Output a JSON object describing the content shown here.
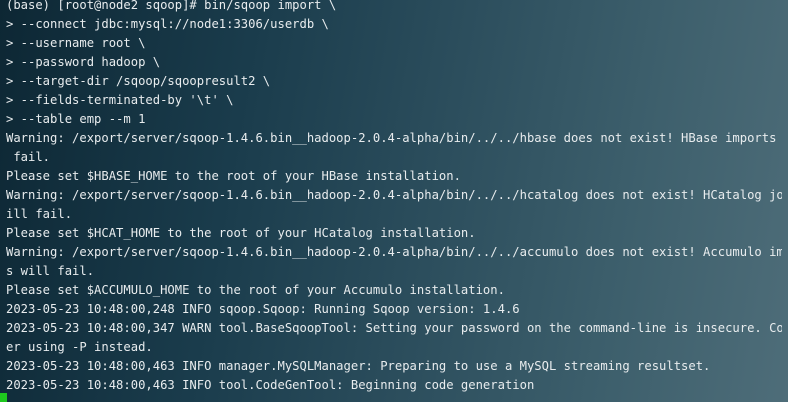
{
  "terminal": {
    "lines": [
      "(base) [root@node2 sqoop]# bin/sqoop import \\",
      "> --connect jdbc:mysql://node1:3306/userdb \\",
      "> --username root \\",
      "> --password hadoop \\",
      "> --target-dir /sqoop/sqoopresult2 \\",
      "> --fields-terminated-by '\\t' \\",
      "> --table emp --m 1",
      "Warning: /export/server/sqoop-1.4.6.bin__hadoop-2.0.4-alpha/bin/../../hbase does not exist! HBase imports will",
      " fail.",
      "Please set $HBASE_HOME to the root of your HBase installation.",
      "Warning: /export/server/sqoop-1.4.6.bin__hadoop-2.0.4-alpha/bin/../../hcatalog does not exist! HCatalog jobs w",
      "ill fail.",
      "Please set $HCAT_HOME to the root of your HCatalog installation.",
      "Warning: /export/server/sqoop-1.4.6.bin__hadoop-2.0.4-alpha/bin/../../accumulo does not exist! Accumulo import",
      "s will fail.",
      "Please set $ACCUMULO_HOME to the root of your Accumulo installation.",
      "2023-05-23 10:48:00,248 INFO sqoop.Sqoop: Running Sqoop version: 1.4.6",
      "2023-05-23 10:48:00,347 WARN tool.BaseSqoopTool: Setting your password on the command-line is insecure. Consid",
      "er using -P instead.",
      "2023-05-23 10:48:00,463 INFO manager.MySQLManager: Preparing to use a MySQL streaming resultset.",
      "2023-05-23 10:48:00,463 INFO tool.CodeGenTool: Beginning code generation"
    ],
    "colors": {
      "text": "#e8ecee",
      "cursor": "#1ec81e"
    }
  }
}
